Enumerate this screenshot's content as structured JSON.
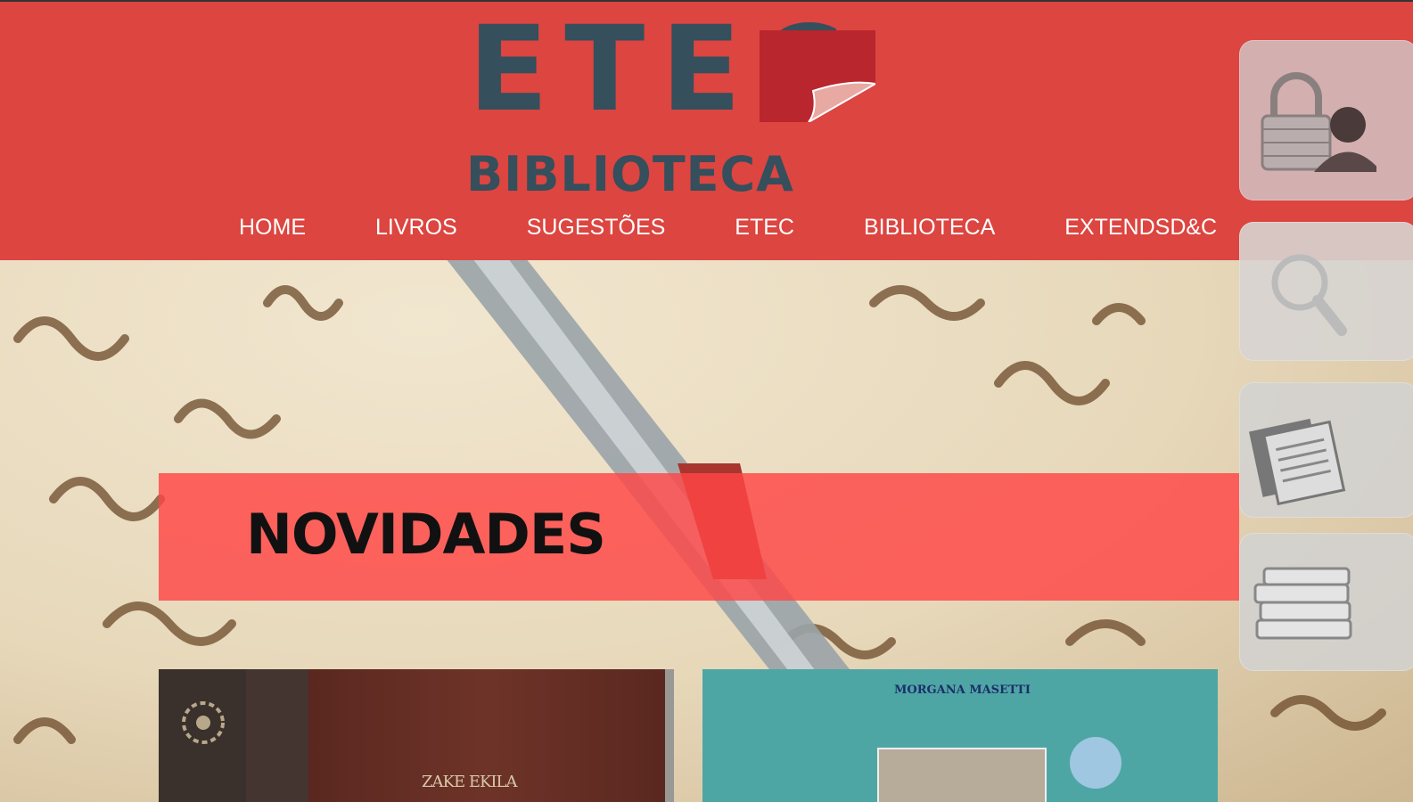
{
  "header": {
    "logo_word": "ETEC",
    "logo_sub": "BIBLIOTECA",
    "colors": {
      "background": "#dc4540",
      "logo": "#354f5c",
      "fold": "#b9262e"
    }
  },
  "nav": {
    "items": [
      {
        "label": "HOME"
      },
      {
        "label": "LIVROS"
      },
      {
        "label": "SUGESTÕES"
      },
      {
        "label": "ETEC"
      },
      {
        "label": "BIBLIOTECA"
      },
      {
        "label": "EXTENDSD&C"
      }
    ]
  },
  "side_tools": [
    {
      "icon": "lock-user-icon"
    },
    {
      "icon": "search-icon"
    },
    {
      "icon": "newspaper-icon"
    },
    {
      "icon": "books-icon"
    }
  ],
  "banner": {
    "title": "NOVIDADES",
    "color": "#ff4646"
  },
  "books": [
    {
      "author": "ZAKE EKILA"
    },
    {
      "author": "MORGANA MASETTI"
    }
  ]
}
